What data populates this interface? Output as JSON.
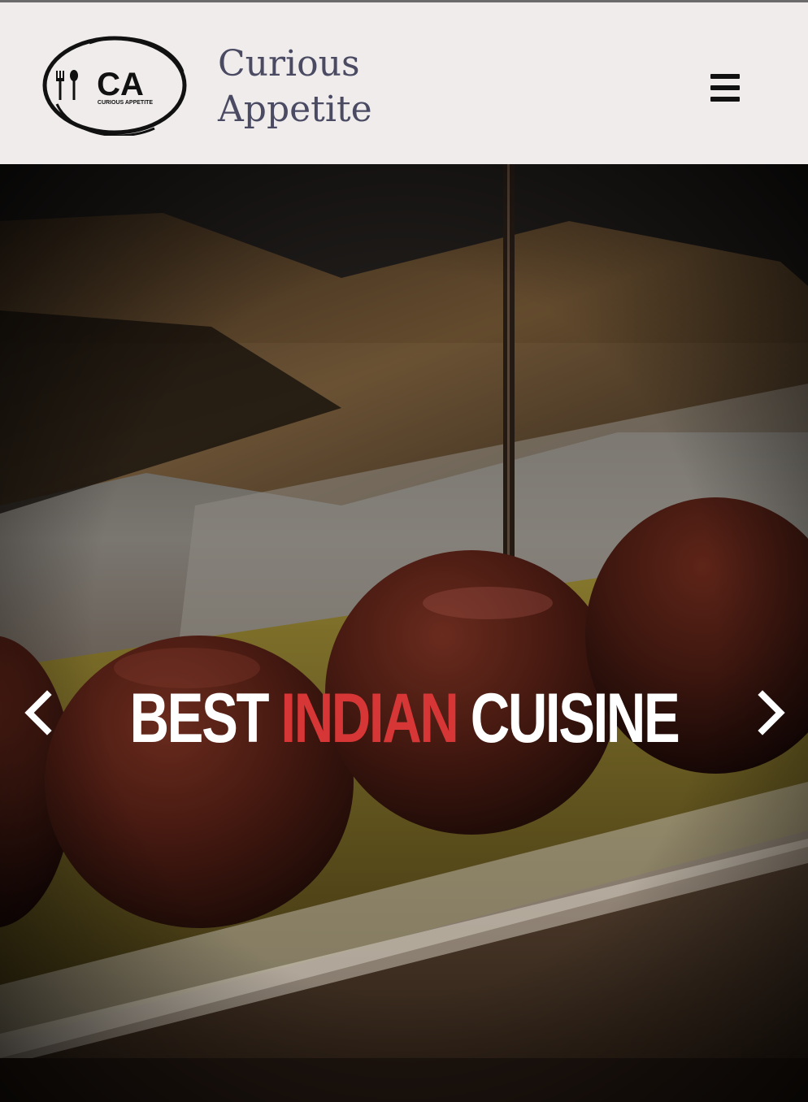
{
  "header": {
    "logo": {
      "monogram": "CA",
      "tagline": "CURIOUS APPETITE",
      "icon": "fork-spoon-icon"
    },
    "brand_line1": "Curious",
    "brand_line2": "Appetite",
    "menu_icon": "hamburger-menu-icon"
  },
  "hero": {
    "image": "gulab-jamun-syrup-pour-photo",
    "title": {
      "part1": "BEST ",
      "highlight": "INDIAN",
      "part2": " CUISINE"
    },
    "prev_icon": "chevron-left-icon",
    "next_icon": "chevron-right-icon"
  },
  "colors": {
    "header_bg": "#f1ecec",
    "brand_text": "#4a4b63",
    "accent_red": "#d63636",
    "hero_text": "#ffffff"
  }
}
